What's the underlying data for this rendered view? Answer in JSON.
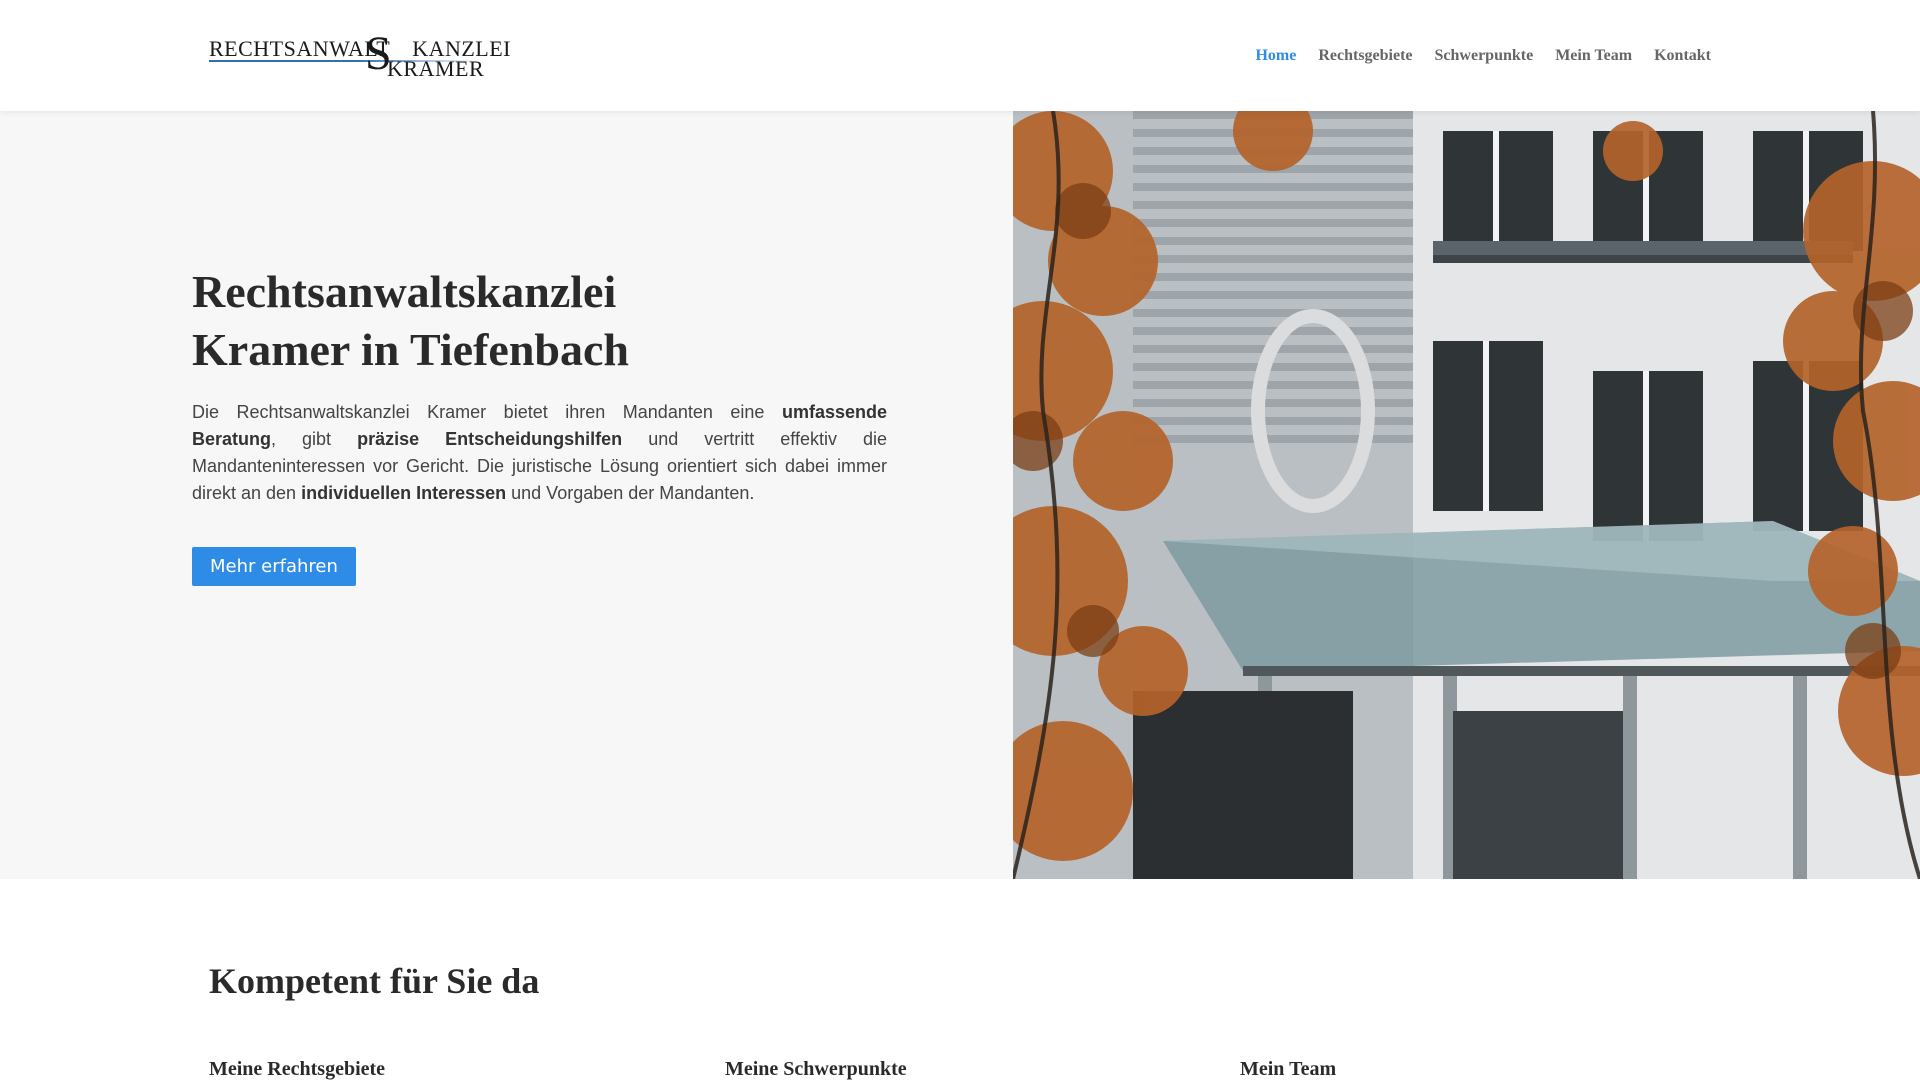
{
  "header": {
    "logo": {
      "line_top": "RECHTSANWALT",
      "line_top_right": "KANZLEI",
      "line_bottom": "KRAMER",
      "monogram": "S"
    },
    "nav": [
      {
        "label": "Home",
        "active": true
      },
      {
        "label": "Rechtsgebiete",
        "active": false
      },
      {
        "label": "Schwerpunkte",
        "active": false
      },
      {
        "label": "Mein Team",
        "active": false
      },
      {
        "label": "Kontakt",
        "active": false
      }
    ]
  },
  "hero": {
    "title_line1": "Rechtsanwaltskanzlei",
    "title_line2": "Kramer in Tiefenbach",
    "text": {
      "p1": "Die Rechtsanwaltskanzlei Kramer bietet ihren Mandanten eine ",
      "b1": "umfassende Beratung",
      "p2": ", gibt ",
      "b2": "präzise Entscheidungshilfen",
      "p3": " und vertritt effektiv die Mandanteninteressen vor Gericht. Die juristische Lösung orientiert sich dabei immer direkt an den ",
      "b3": "individuellen Interessen",
      "p4": " und Vorgaben der Mandanten."
    },
    "button_label": "Mehr erfahren"
  },
  "section": {
    "title": "Kompetent für Sie da",
    "columns": [
      {
        "heading": "Meine Rechtsgebiete"
      },
      {
        "heading": "Meine Schwerpunkte"
      },
      {
        "heading": "Mein Team"
      }
    ]
  },
  "colors": {
    "accent": "#2e8ce6",
    "hero_bg": "#f7f7f7",
    "nav_text": "#666666",
    "heading_text": "#2a2a2a"
  }
}
